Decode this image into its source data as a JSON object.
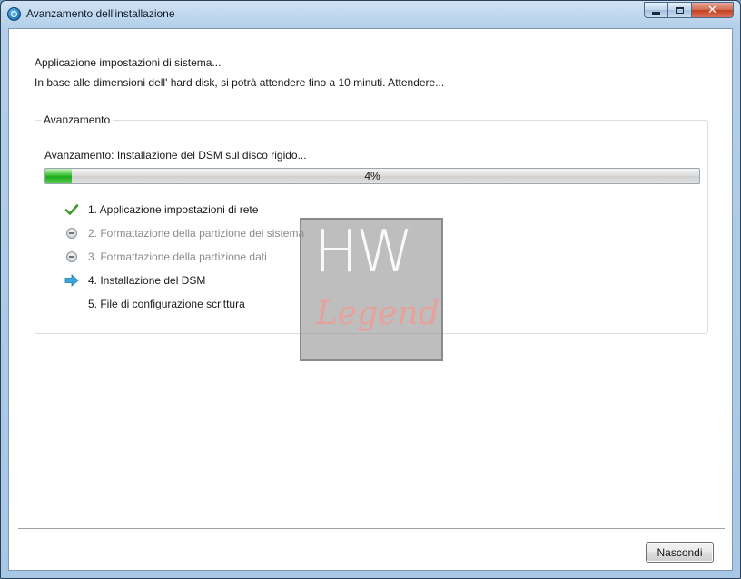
{
  "window": {
    "title": "Avanzamento dell'installazione",
    "buttons": {
      "minimize": "minimize-icon",
      "maximize": "maximize-icon",
      "close": "close-icon",
      "close_glyph": "✕"
    }
  },
  "message": {
    "line1": "Applicazione impostazioni di sistema...",
    "line2": "In base alle dimensioni dell' hard disk, si potrà attendere fino a 10 minuti. Attendere..."
  },
  "group": {
    "legend": "Avanzamento",
    "status": "Avanzamento: Installazione del DSM sul disco rigido...",
    "progress": {
      "percent": 4,
      "label": "4%",
      "fill_color": "#2cb82a"
    }
  },
  "steps": [
    {
      "label": "1. Applicazione impostazioni di rete",
      "state": "done",
      "icon": "check-icon"
    },
    {
      "label": "2. Formattazione della partizione del sistema",
      "state": "pending",
      "icon": "pending-icon"
    },
    {
      "label": "3. Formattazione della partizione dati",
      "state": "pending",
      "icon": "pending-icon"
    },
    {
      "label": "4. Installazione del DSM",
      "state": "current",
      "icon": "arrow-right-icon"
    },
    {
      "label": "5. File di configurazione scrittura",
      "state": "todo",
      "icon": ""
    }
  ],
  "watermark": {
    "line1": "HW",
    "line2": "Legend"
  },
  "footer": {
    "hide_button": "Nascondi"
  }
}
